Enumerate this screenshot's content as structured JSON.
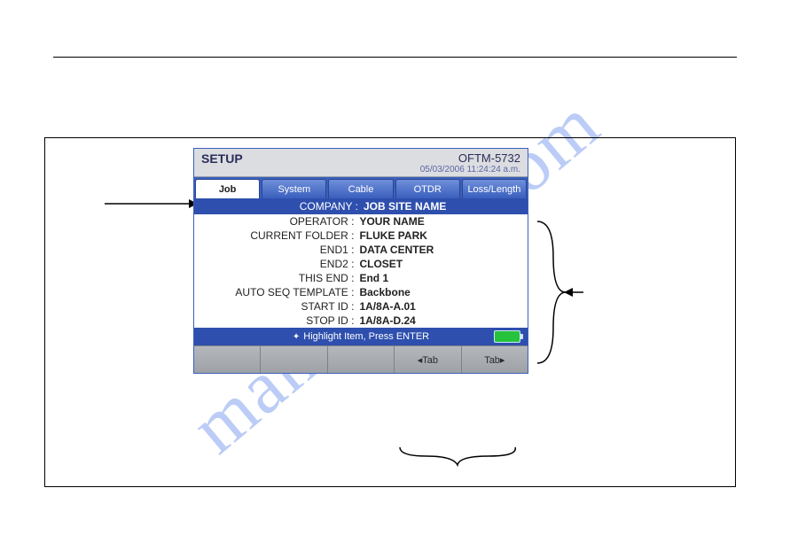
{
  "header": {
    "title": "SETUP",
    "model": "OFTM-5732",
    "datetime": "05/03/2006  11:24:24 a.m."
  },
  "tabs": [
    {
      "label": "Job",
      "active": true
    },
    {
      "label": "System",
      "active": false
    },
    {
      "label": "Cable",
      "active": false
    },
    {
      "label": "OTDR",
      "active": false
    },
    {
      "label": "Loss/Length",
      "active": false
    }
  ],
  "highlighted_field": {
    "label": "COMPANY :",
    "value": "JOB SITE NAME"
  },
  "fields": [
    {
      "label": "OPERATOR :",
      "value": "YOUR NAME"
    },
    {
      "label": "CURRENT FOLDER :",
      "value": "FLUKE PARK"
    },
    {
      "label": "END1 :",
      "value": "DATA CENTER"
    },
    {
      "label": "END2 :",
      "value": "CLOSET"
    },
    {
      "label": "THIS END :",
      "value": "End 1"
    },
    {
      "label": "AUTO SEQ TEMPLATE :",
      "value": "Backbone"
    },
    {
      "label": "START ID :",
      "value": "1A/8A-A.01"
    },
    {
      "label": "STOP ID :",
      "value": "1A/8A-D.24"
    }
  ],
  "hint": "Highlight Item, Press ENTER",
  "soft_buttons": {
    "b1": "",
    "b2": "",
    "b3": "",
    "b4": "◂Tab",
    "b5": "Tab▸"
  },
  "watermark": "manualslib.com"
}
